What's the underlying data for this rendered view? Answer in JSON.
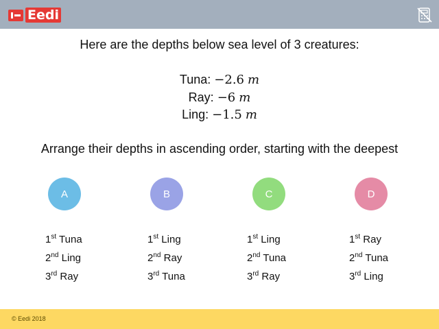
{
  "brand": {
    "name": "Eedi",
    "copyright": "© Eedi 2018"
  },
  "header": {
    "calculator_icon": "no-calculator-icon"
  },
  "question": {
    "intro": "Here are the depths below sea level of 3 creatures:",
    "creatures": [
      {
        "name": "Tuna:",
        "value": "−2.6",
        "unit": "m"
      },
      {
        "name": "Ray:",
        "value": "−6",
        "unit": "m"
      },
      {
        "name": "Ling:",
        "value": "−1.5",
        "unit": "m"
      }
    ],
    "task": "Arrange their depths in ascending order, starting with the deepest"
  },
  "options": [
    {
      "letter": "A",
      "color": "#6cbde6",
      "order": [
        {
          "rank": "1",
          "suffix": "st",
          "name": "Tuna"
        },
        {
          "rank": "2",
          "suffix": "nd",
          "name": "Ling"
        },
        {
          "rank": "3",
          "suffix": "rd",
          "name": "Ray"
        }
      ]
    },
    {
      "letter": "B",
      "color": "#9aa3e6",
      "order": [
        {
          "rank": "1",
          "suffix": "st",
          "name": "Ling"
        },
        {
          "rank": "2",
          "suffix": "nd",
          "name": "Ray"
        },
        {
          "rank": "3",
          "suffix": "rd",
          "name": "Tuna"
        }
      ]
    },
    {
      "letter": "C",
      "color": "#92dc7e",
      "order": [
        {
          "rank": "1",
          "suffix": "st",
          "name": "Ling"
        },
        {
          "rank": "2",
          "suffix": "nd",
          "name": "Tuna"
        },
        {
          "rank": "3",
          "suffix": "rd",
          "name": "Ray"
        }
      ]
    },
    {
      "letter": "D",
      "color": "#e58ba6",
      "order": [
        {
          "rank": "1",
          "suffix": "st",
          "name": "Ray"
        },
        {
          "rank": "2",
          "suffix": "nd",
          "name": "Tuna"
        },
        {
          "rank": "3",
          "suffix": "rd",
          "name": "Ling"
        }
      ]
    }
  ]
}
